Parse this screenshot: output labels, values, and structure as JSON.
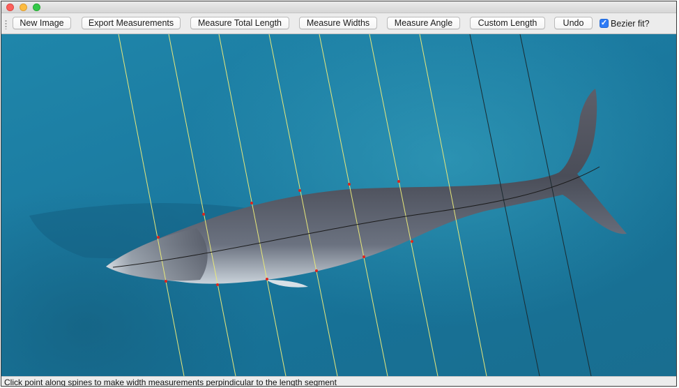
{
  "window": {
    "controls": [
      "close",
      "minimize",
      "zoom"
    ]
  },
  "toolbar": {
    "new_image": "New Image",
    "export_measurements": "Export Measurements",
    "measure_total_length": "Measure Total Length",
    "measure_widths": "Measure Widths",
    "measure_angle": "Measure Angle",
    "custom_length": "Custom Length",
    "undo": "Undo",
    "bezier_fit_label": "Bezier fit?",
    "bezier_fit_checked": true
  },
  "canvas": {
    "image_subject": "whale",
    "measurement_line_colors": {
      "width_lines": "#e8e87a",
      "spine_line": "#1a1a1a",
      "points": "#e0241b"
    }
  },
  "status": {
    "message": "Click point along spines to make width measurements perpindicular to the length segment"
  },
  "icons": {
    "checkbox": "checkmark-icon",
    "grip": "toolbar-grip-icon"
  }
}
